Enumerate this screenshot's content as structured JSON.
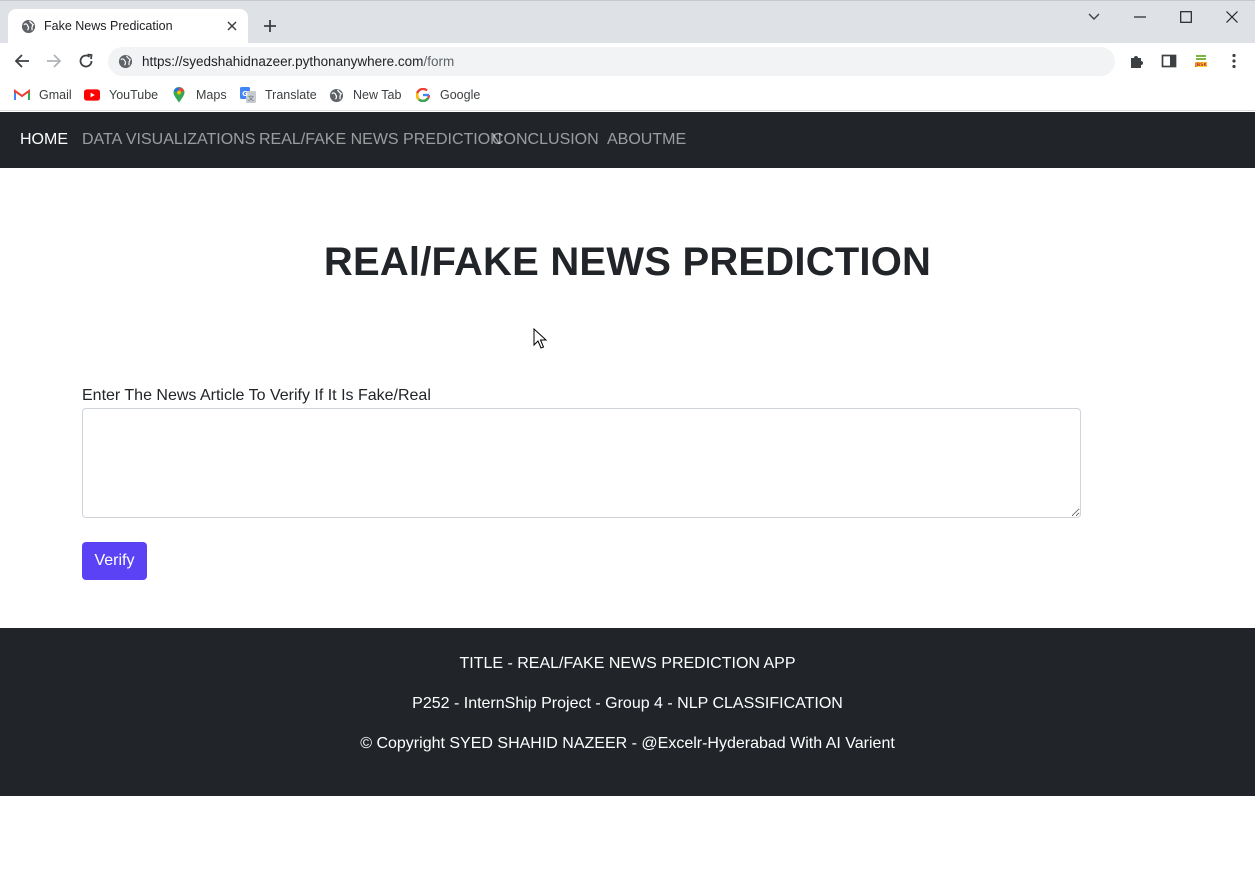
{
  "browser": {
    "tab_title": "Fake News Predication",
    "url_host": "https://syedshahidnazeer.pythonanywhere.com",
    "url_path": "/form",
    "bookmarks": [
      {
        "label": "Gmail",
        "icon": "gmail-icon"
      },
      {
        "label": "YouTube",
        "icon": "youtube-icon"
      },
      {
        "label": "Maps",
        "icon": "maps-icon"
      },
      {
        "label": "Translate",
        "icon": "translate-icon"
      },
      {
        "label": "New Tab",
        "icon": "globe-icon"
      },
      {
        "label": "Google",
        "icon": "google-icon"
      }
    ]
  },
  "navbar": {
    "items": [
      {
        "label": "HOME",
        "active": true
      },
      {
        "label": "DATA VISUALIZATIONS",
        "active": false
      },
      {
        "label": "REAL/FAKE NEWS PREDICTION",
        "active": false
      },
      {
        "label": "CONCLUSION",
        "active": false
      },
      {
        "label": "ABOUTME",
        "active": false
      }
    ]
  },
  "main": {
    "heading": "REAl/FAKE NEWS PREDICTION",
    "form_label": "Enter The News Article To Verify If It Is Fake/Real",
    "article_value": "",
    "verify_label": "Verify"
  },
  "footer": {
    "line1": "TITLE - REAL/FAKE NEWS PREDICTION APP",
    "line2": "P252 - InternShip Project - Group 4 - NLP CLASSIFICATION",
    "line3": "© Copyright SYED SHAHID NAZEER - @Excelr-Hyderabad With AI Varient"
  },
  "colors": {
    "navbar_bg": "#212529",
    "button_bg": "#5b43f5",
    "footer_bg": "#212529"
  }
}
